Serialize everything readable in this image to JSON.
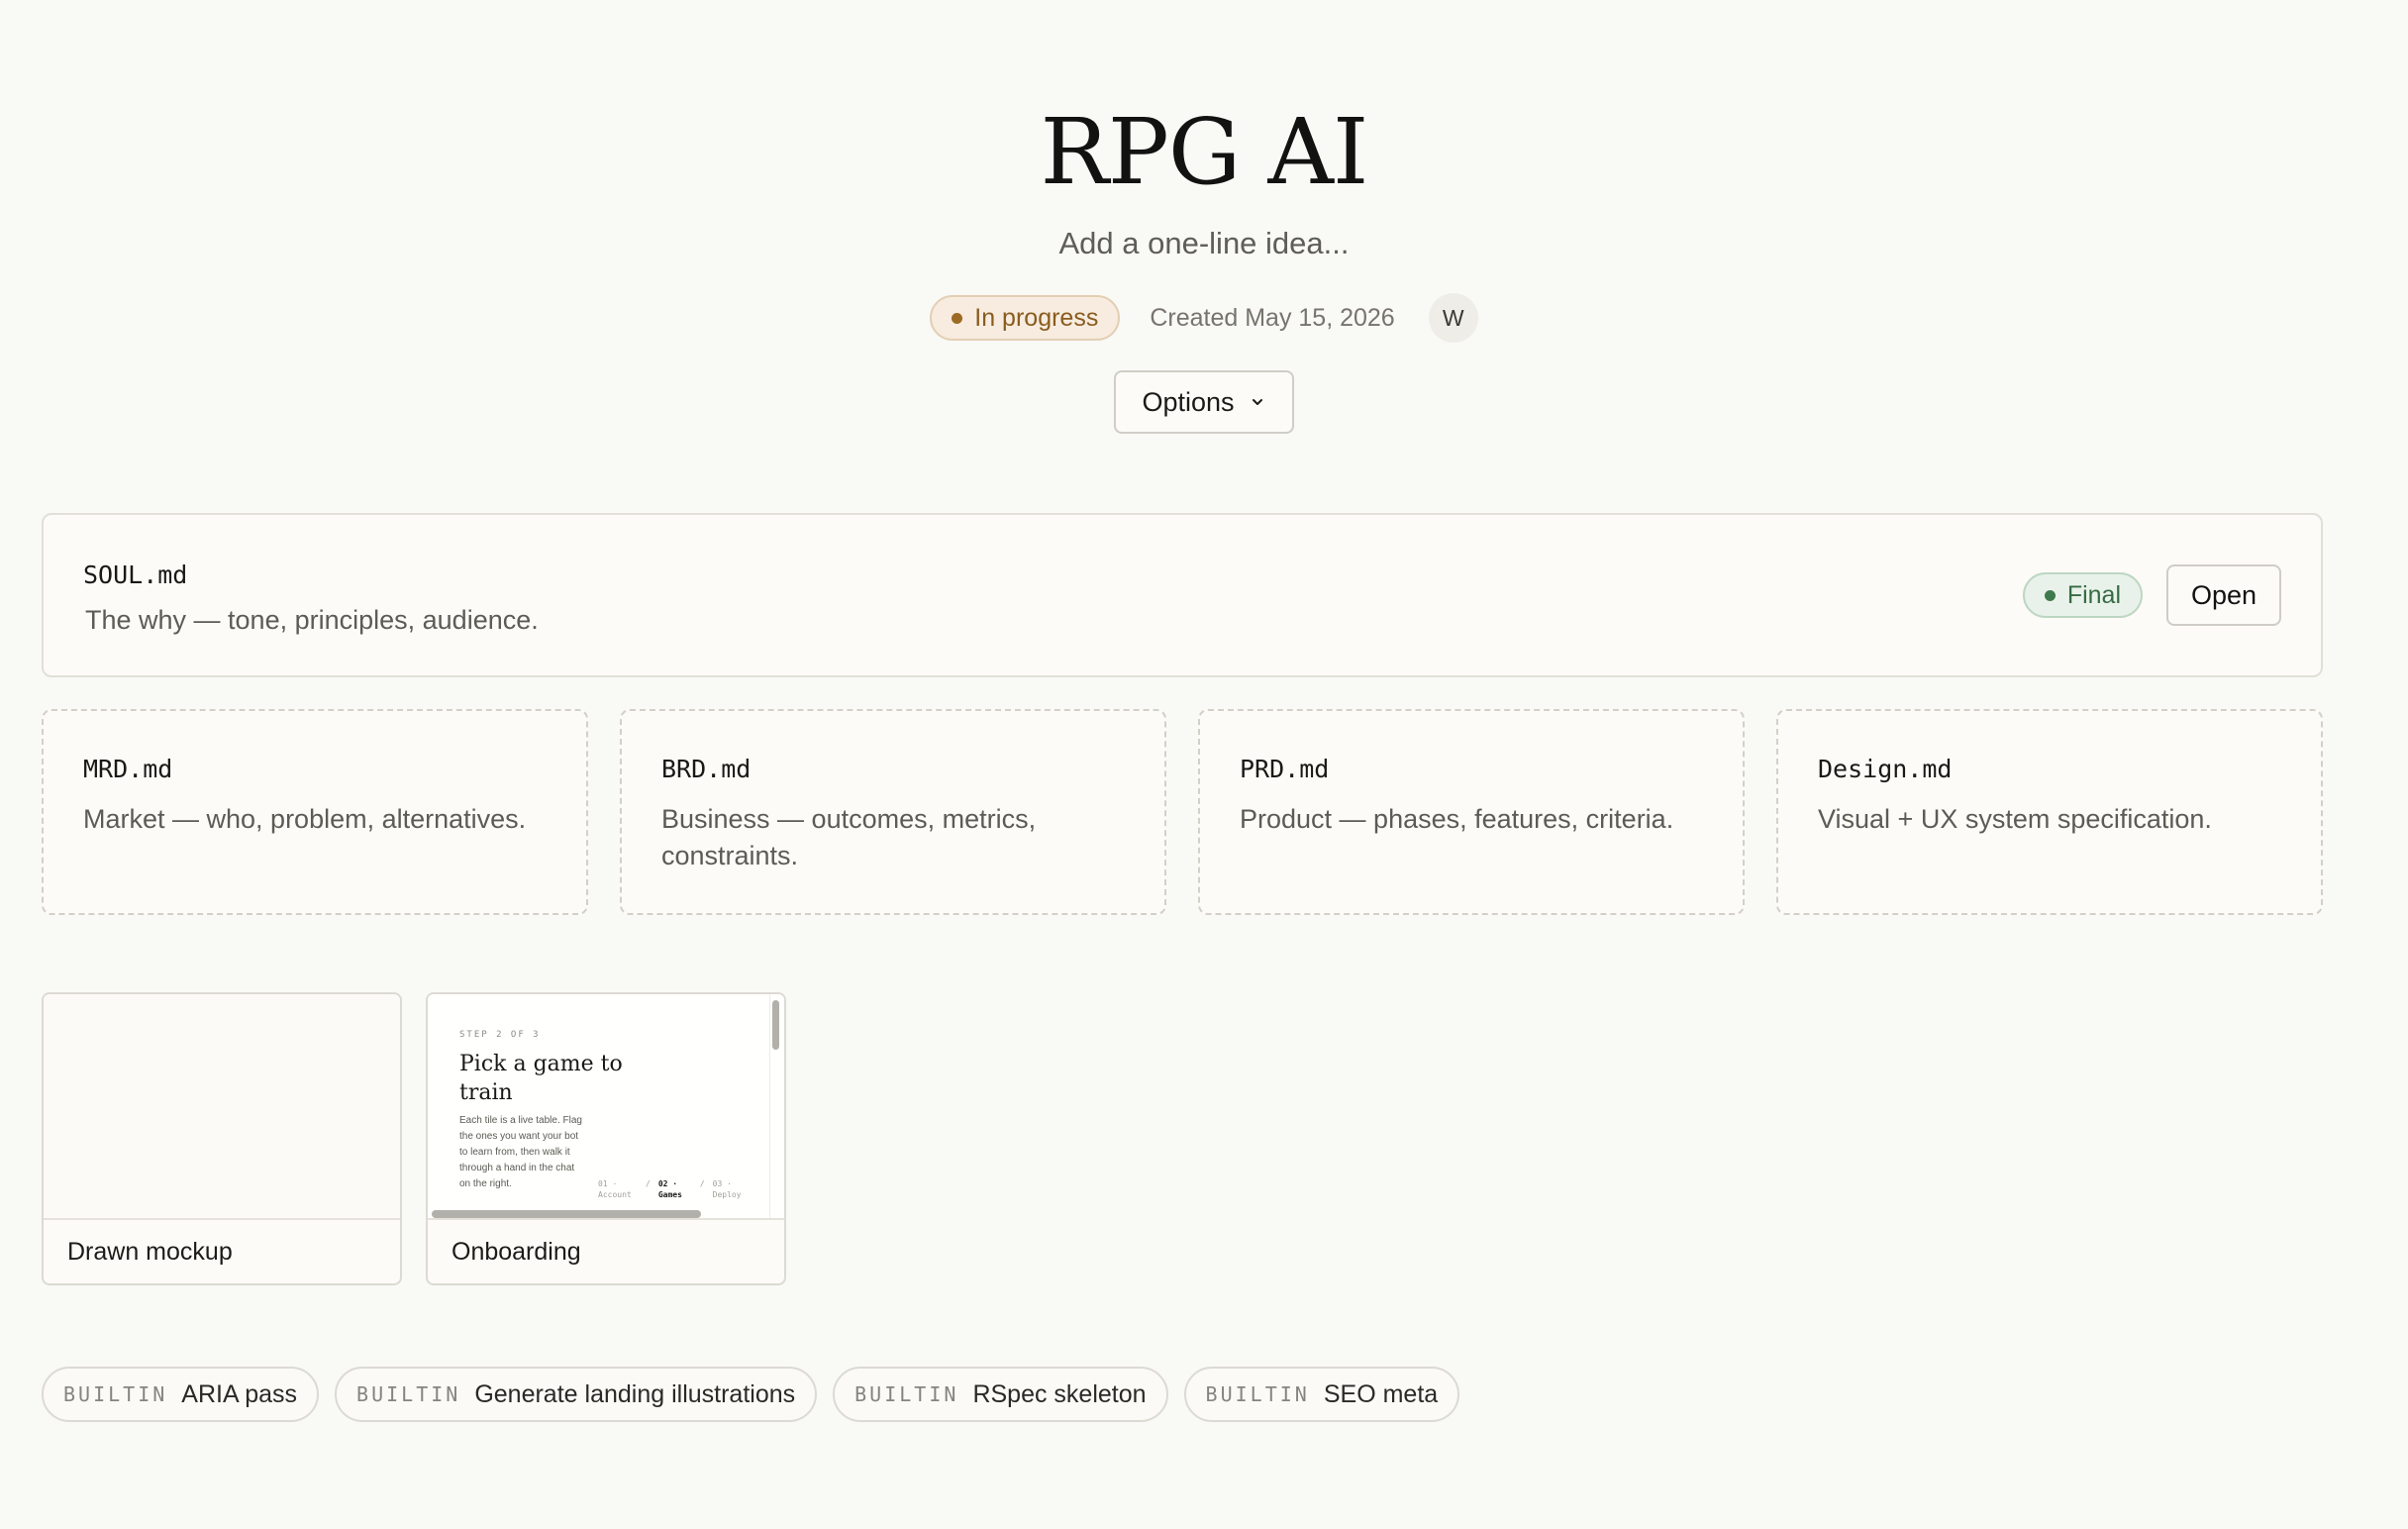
{
  "header": {
    "title": "RPG AI",
    "subtitle": "Add a one-line idea...",
    "status": "In progress",
    "created": "Created May 15, 2026",
    "avatar_initial": "W",
    "options_label": "Options"
  },
  "soul": {
    "name": "SOUL.md",
    "description": "The why — tone, principles, audience.",
    "status": "Final",
    "open_label": "Open"
  },
  "docs": [
    {
      "name": "MRD.md",
      "description": "Market — who, problem, alternatives."
    },
    {
      "name": "BRD.md",
      "description": "Business — outcomes, metrics, constraints."
    },
    {
      "name": "PRD.md",
      "description": "Product — phases, features, criteria."
    },
    {
      "name": "Design.md",
      "description": "Visual + UX system specification."
    }
  ],
  "mockups": [
    {
      "label": "Drawn mockup"
    },
    {
      "label": "Onboarding",
      "preview": {
        "step": "STEP 2 OF 3",
        "title": "Pick a game to train",
        "body": "Each tile is a live table. Flag the ones you want your bot to learn from, then walk it through a hand in the chat on the right.",
        "steps": [
          "01 · Account",
          "02 · Games",
          "03 · Deploy"
        ],
        "separator": "/"
      }
    }
  ],
  "tags": [
    {
      "kind": "BUILTIN",
      "label": "ARIA pass"
    },
    {
      "kind": "BUILTIN",
      "label": "Generate landing illustrations"
    },
    {
      "kind": "BUILTIN",
      "label": "RSpec skeleton"
    },
    {
      "kind": "BUILTIN",
      "label": "SEO meta"
    }
  ],
  "colors": {
    "background": "#f9f9f6",
    "in_progress": "#8a5b1f",
    "final": "#356b44"
  },
  "icons": {
    "status_dot": "dot",
    "options_chevron": "chevron-down-icon"
  }
}
